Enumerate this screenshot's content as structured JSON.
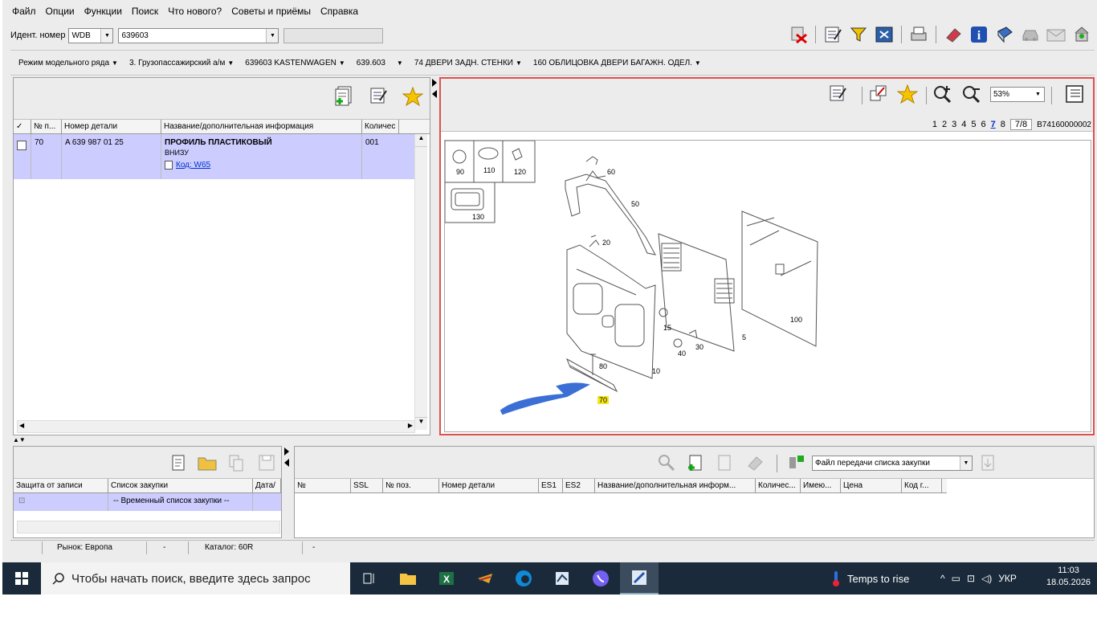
{
  "menu": [
    "Файл",
    "Опции",
    "Функции",
    "Поиск",
    "Что нового?",
    "Советы и приёмы",
    "Справка"
  ],
  "ident": {
    "label": "Идент. номер",
    "prefix": "WDB",
    "number": "639603"
  },
  "toolbar_icons": [
    "remove-icon",
    "edit-list-icon",
    "filter-icon",
    "view-icon",
    "print-icon",
    "eraser-icon",
    "info-icon",
    "book-icon",
    "car-icon",
    "mail-icon",
    "update-icon"
  ],
  "breadcrumb": [
    "Режим модельного ряда",
    "3. Грузопассажирский а/м",
    "639603 KASTENWAGEN",
    "639.603",
    "74 ДВЕРИ ЗАДН. СТЕНКИ",
    "160 ОБЛИЦОВКА ДВЕРИ БАГАЖН. ОДЕЛ."
  ],
  "parts_table": {
    "headers": [
      "✓",
      "№ п...",
      "Номер детали",
      "Название/дополнительная информация",
      "Количес"
    ],
    "rows": [
      {
        "pos": "70",
        "part": "A 639 987 01 25",
        "name": "ПРОФИЛЬ ПЛАСТИКОВЫЙ",
        "sub": "ВНИЗУ",
        "code": "Код: W65",
        "qty": "001"
      }
    ]
  },
  "viewer": {
    "zoom": "53%",
    "pages": [
      "1",
      "2",
      "3",
      "4",
      "5",
      "6",
      "7",
      "8"
    ],
    "current_page": "7",
    "page_of": "7/8",
    "image_id": "B74160000002"
  },
  "diagram_labels": [
    "90",
    "110",
    "120",
    "130",
    "60",
    "50",
    "20",
    "15",
    "40",
    "30",
    "5",
    "100",
    "80",
    "10",
    "70"
  ],
  "purchase_lists": {
    "headers": [
      "Защита от записи",
      "Список закупки",
      "Дата/"
    ],
    "row": "-- Временный список закупки --"
  },
  "transfer": {
    "select": "Файл передачи списка закупки",
    "headers": [
      "№",
      "SSL",
      "№ поз.",
      "Номер детали",
      "ES1",
      "ES2",
      "Название/дополнительная информ...",
      "Количес...",
      "Имею...",
      "Цена",
      "Код г..."
    ]
  },
  "status": {
    "market": "Рынок: Европа",
    "dash1": "-",
    "catalog": "Каталог: 60R",
    "dash2": "-"
  },
  "taskbar": {
    "search": "Чтобы начать поиск, введите здесь запрос",
    "weather": "Temps to rise",
    "lang": "УКР",
    "time": "11:03",
    "date": "18.05.2026"
  }
}
